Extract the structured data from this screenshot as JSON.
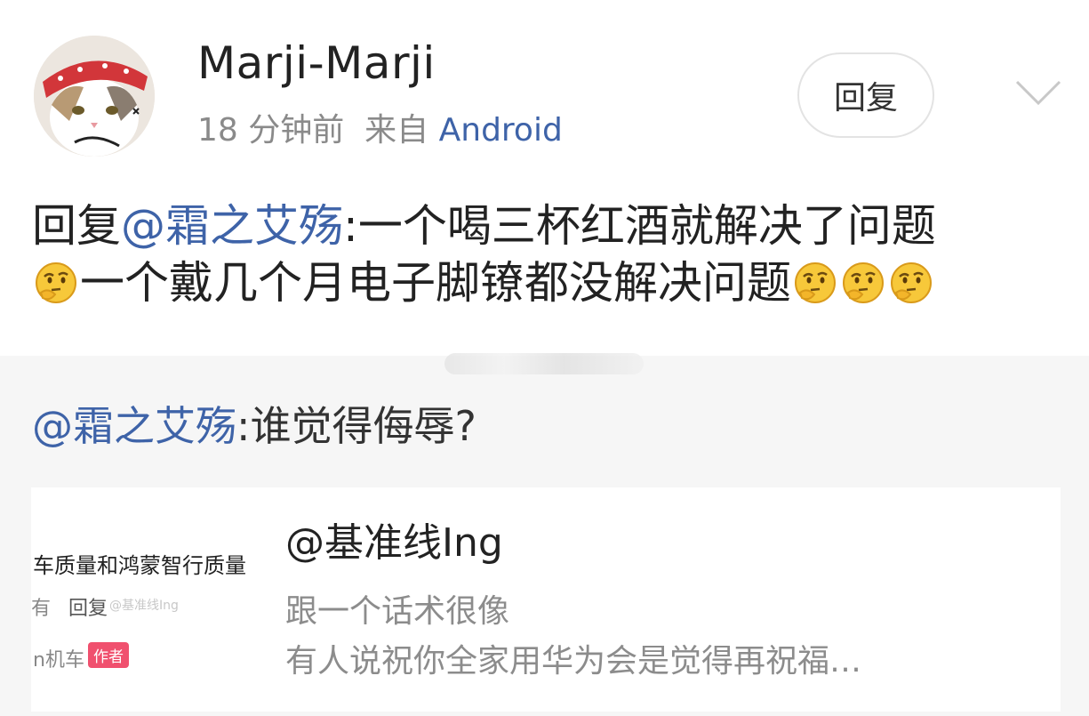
{
  "post": {
    "author": "Marji-Marji",
    "time": "18 分钟前",
    "from_label": "来自",
    "source": "Android",
    "reply_button": "回复",
    "body": {
      "prefix": "回复",
      "mention": "@霜之艾殇",
      "line1_rest": ":一个喝三杯红酒就解决了问题",
      "line2": "一个戴几个月电子脚镣都没解决问题"
    },
    "emoji_name": "thinking-face-emoji"
  },
  "quoted": {
    "mention": "@霜之艾殇",
    "text": ":谁觉得侮辱?",
    "card": {
      "title": "@基准线Ing",
      "desc_line1": "跟一个话术很像",
      "desc_line2": "有人说祝你全家用华为会是觉得再祝福…",
      "thumb": {
        "headline": "车质量和鸿蒙智行质量",
        "reply_left": "有",
        "reply": "回复",
        "watermark": "@基准线Ing",
        "user": "n机车",
        "author_tag": "作者"
      }
    }
  },
  "colors": {
    "link": "#3e63a8",
    "meta": "#8a8a8a",
    "quote_bg": "#f6f6f6",
    "author_tag": "#f0506e"
  }
}
